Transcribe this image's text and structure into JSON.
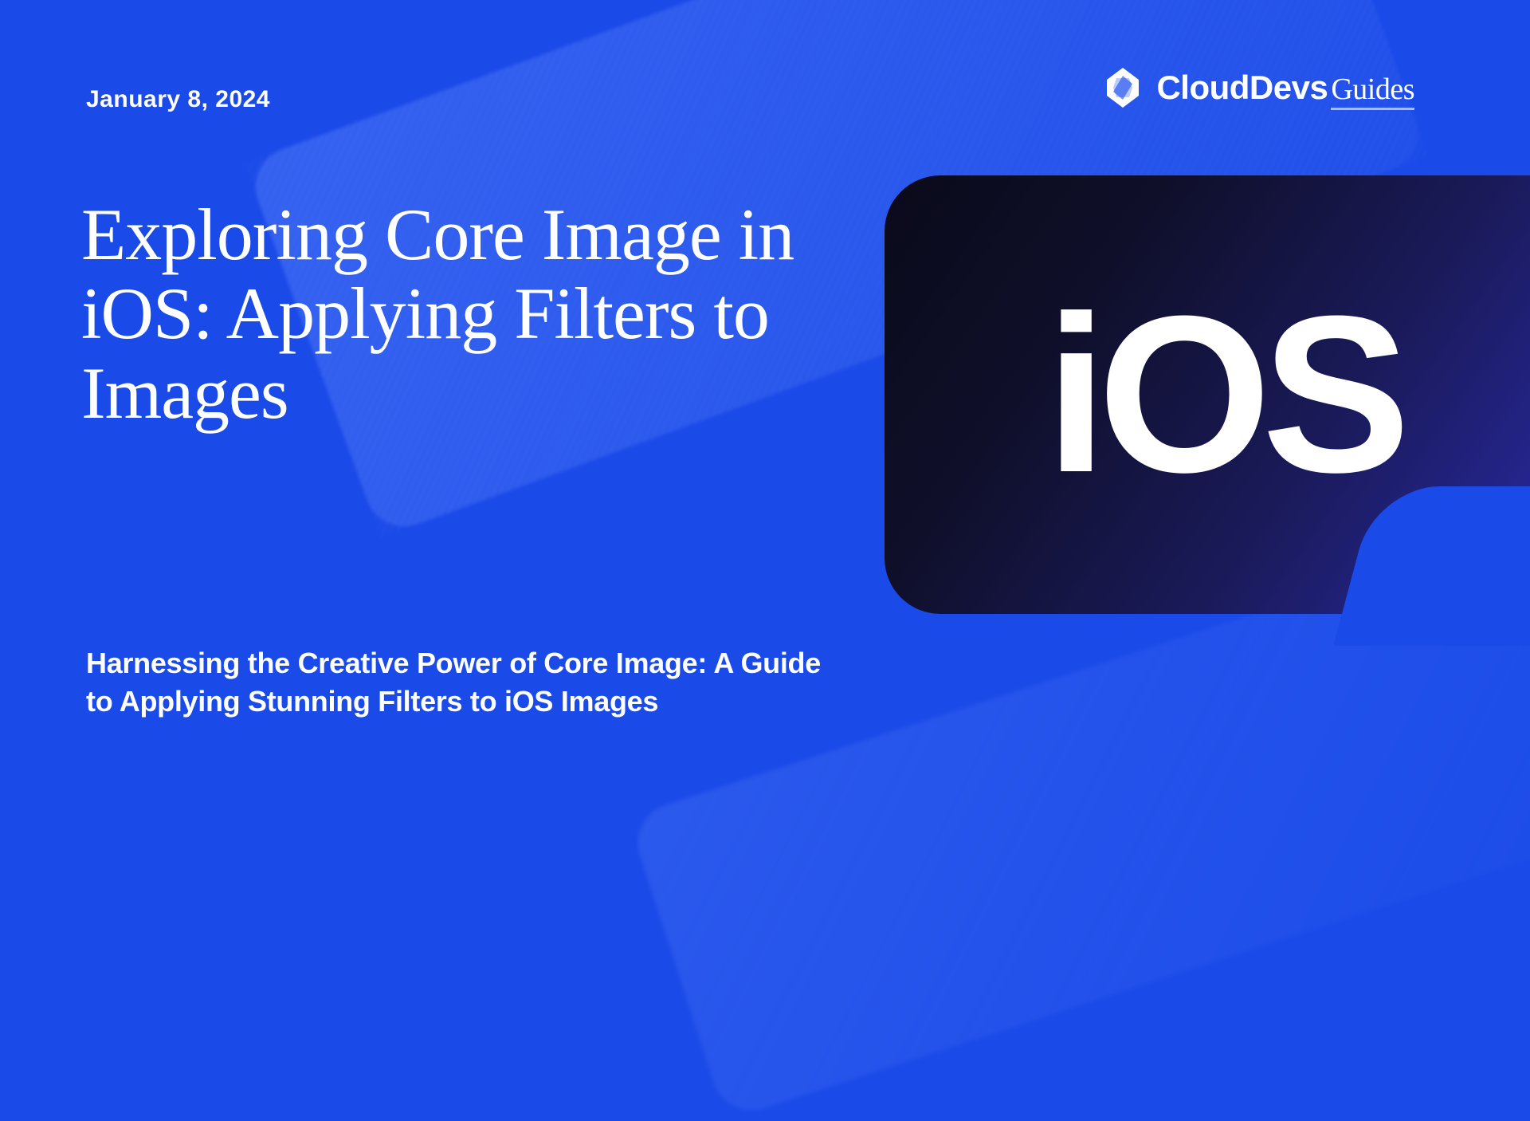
{
  "date": "January 8, 2024",
  "logo": {
    "brand": "CloudDevs",
    "suffix": "Guides"
  },
  "title": "Exploring Core Image in iOS: Applying Filters to Images",
  "subtitle": "Harnessing the Creative Power of Core Image: A Guide to Applying Stunning Filters to iOS Images",
  "card": {
    "label": "iOS"
  }
}
